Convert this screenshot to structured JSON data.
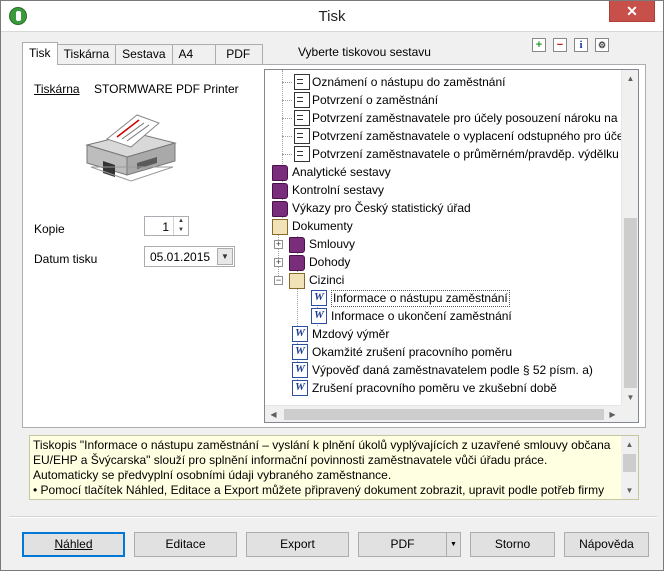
{
  "window": {
    "title": "Tisk",
    "close_glyph": "✕"
  },
  "tabs": [
    {
      "label": "Tisk",
      "active": true
    },
    {
      "label": "Tiskárna",
      "active": false
    },
    {
      "label": "Sestava",
      "active": false
    },
    {
      "label": "A4",
      "active": false
    },
    {
      "label": "PDF",
      "active": false
    }
  ],
  "sestava_caption": "Vyberte tiskovou sestavu",
  "toolbar": {
    "plus_glyph": "+",
    "minus_glyph": "−",
    "info_glyph": "i",
    "config_glyph": "⚙"
  },
  "print": {
    "printer_label": "Tiskárna",
    "printer_value": "STORMWARE PDF Printer",
    "copies_label": "Kopie",
    "copies_value": "1",
    "date_label": "Datum tisku",
    "date_value": "05.01.2015"
  },
  "tree": {
    "rows": [
      {
        "label": "Oznámení o nástupu do zaměstnání",
        "icon": "document-icon"
      },
      {
        "label": "Potvrzení o zaměstnání",
        "icon": "document-icon"
      },
      {
        "label": "Potvrzení zaměstnavatele pro účely posouzení nároku na p",
        "icon": "document-icon"
      },
      {
        "label": "Potvrzení zaměstnavatele o vyplacení odstupného pro účel",
        "icon": "document-icon"
      },
      {
        "label": "Potvrzení zaměstnavatele o průměrném/pravděp. výdělku",
        "icon": "document-icon"
      },
      {
        "label": "Analytické sestavy",
        "icon": "book-icon"
      },
      {
        "label": "Kontrolní sestavy",
        "icon": "book-icon"
      },
      {
        "label": "Výkazy pro Český statistický úřad",
        "icon": "book-icon"
      },
      {
        "label": "Dokumenty",
        "icon": "open-book-icon"
      },
      {
        "label": "Smlouvy",
        "icon": "book-icon"
      },
      {
        "label": "Dohody",
        "icon": "book-icon"
      },
      {
        "label": "Cizinci",
        "icon": "open-book-icon"
      },
      {
        "label": "Informace o nástupu zaměstnání",
        "icon": "word-icon",
        "selected": true
      },
      {
        "label": "Informace o ukončení zaměstnání",
        "icon": "word-icon"
      },
      {
        "label": "Mzdový výměr",
        "icon": "word-icon"
      },
      {
        "label": "Okamžité zrušení pracovního poměru",
        "icon": "word-icon"
      },
      {
        "label": "Výpověď daná zaměstnavatelem podle § 52 písm. a)",
        "icon": "word-icon"
      },
      {
        "label": "Zrušení pracovního poměru ve zkušební době",
        "icon": "word-icon"
      }
    ],
    "expand_plus": "+",
    "expand_minus": "−",
    "word_glyph": "W"
  },
  "description": {
    "lines": [
      "Tiskopis \"Informace o nástupu zaměstnání – vyslání k plnění úkolů vyplývajících z uzavřené smlouvy občana",
      "EU/EHP a Švýcarska\" slouží pro splnění informační povinnosti zaměstnavatele vůči úřadu práce.",
      "Automaticky se předvyplní osobními údaji vybraného zaměstnance.",
      "• Pomocí tlačítek Náhled, Editace a Export můžete připravený dokument zobrazit, upravit podle potřeb firmy"
    ]
  },
  "buttons": {
    "preview": "Náhled",
    "edit": "Editace",
    "export": "Export",
    "pdf": "PDF",
    "cancel": "Storno",
    "help": "Nápověda"
  },
  "scroll_glyphs": {
    "up": "▲",
    "down": "▼",
    "left": "◀",
    "right": "▶"
  }
}
